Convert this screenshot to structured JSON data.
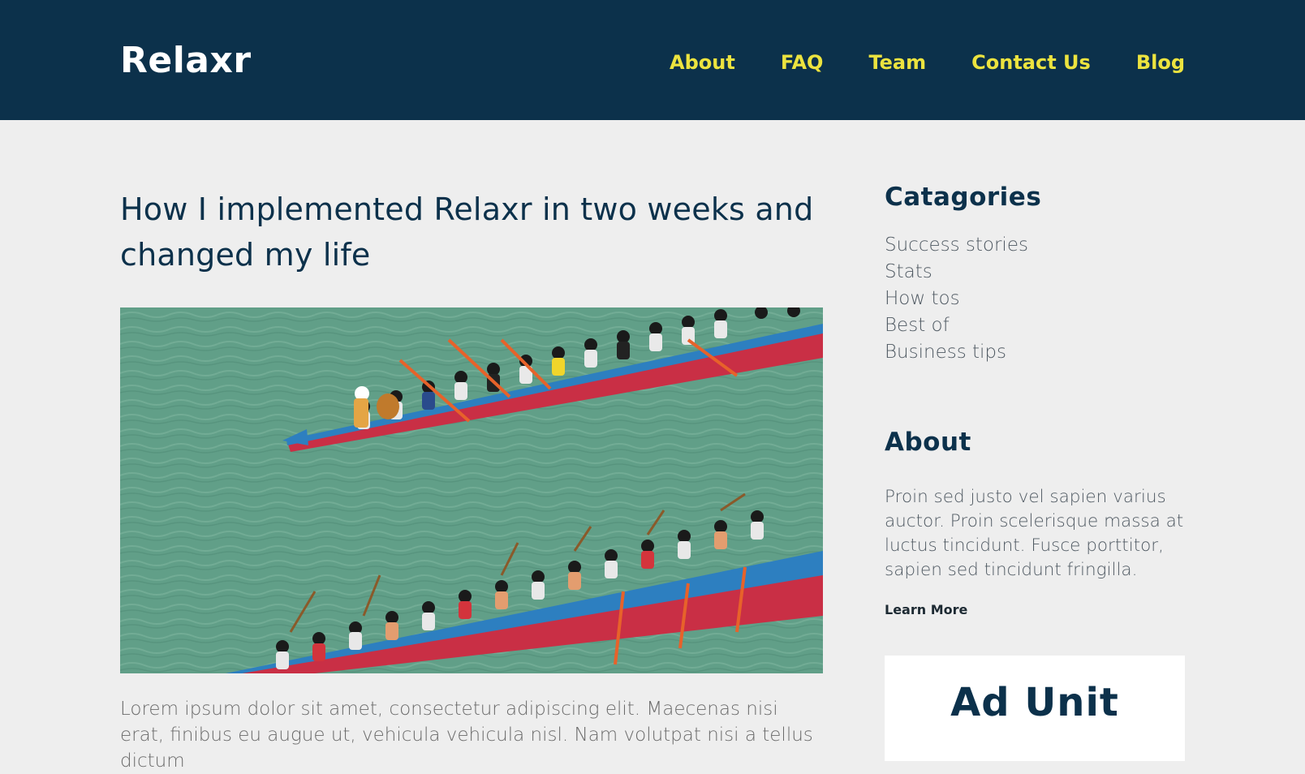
{
  "site": {
    "logo": "Relaxr"
  },
  "nav": {
    "items": [
      "About",
      "FAQ",
      "Team",
      "Contact Us",
      "Blog"
    ]
  },
  "post": {
    "title": "How I implemented Relaxr in two weeks and changed my life",
    "excerpt": "Lorem ipsum dolor sit amet, consectetur adipiscing elit. Maecenas nisi erat, finibus eu augue ut, vehicula vehicula nisl. Nam volutpat nisi a tellus dictum"
  },
  "sidebar": {
    "categories_heading": "Catagories",
    "categories": [
      "Success stories",
      "Stats",
      "How tos",
      "Best of",
      "Business tips"
    ],
    "about_heading": "About",
    "about_text": "Proin sed justo vel sapien varius auctor. Proin scelerisque massa at luctus tincidunt. Fusce porttitor, sapien sed tincidunt fringilla.",
    "learn_more": "Learn More",
    "ad_label": "Ad Unit"
  },
  "colors": {
    "header_bg": "#0c314b",
    "nav_link": "#ece33f",
    "page_bg": "#eeeeee",
    "heading": "#0c314b"
  }
}
